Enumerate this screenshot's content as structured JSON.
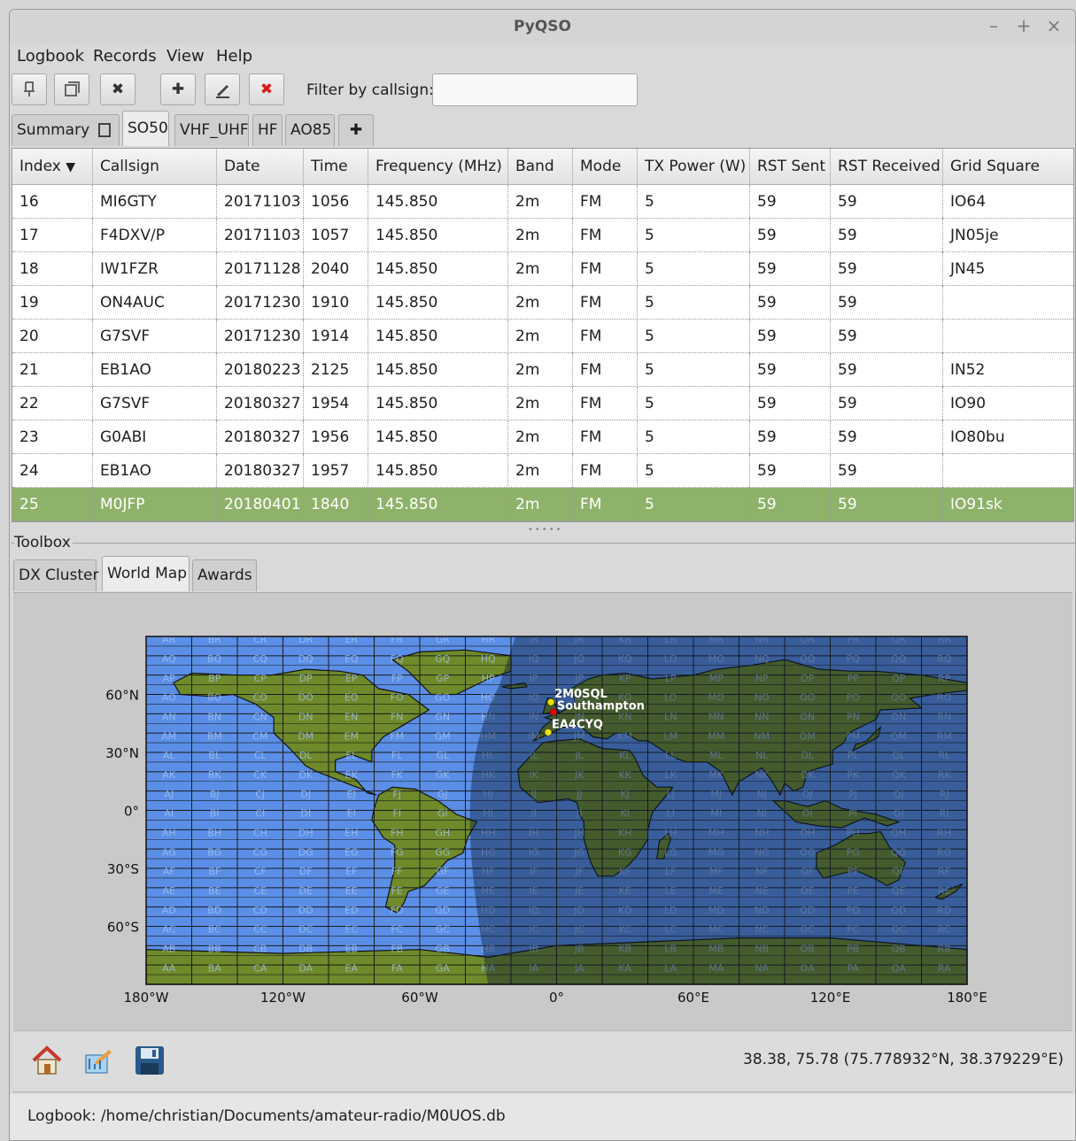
{
  "window": {
    "title": "PyQSO",
    "minimize": "–",
    "maximize": "+",
    "close": "×"
  },
  "menu": [
    "Logbook",
    "Records",
    "View",
    "Help"
  ],
  "toolbar": {
    "filter_label": "Filter by callsign:",
    "filter_value": ""
  },
  "logbook_tabs": [
    "Summary",
    "SO50",
    "VHF_UHF",
    "HF",
    "AO85"
  ],
  "active_logbook_tab": "SO50",
  "columns": [
    "Index",
    "Callsign",
    "Date",
    "Time",
    "Frequency (MHz)",
    "Band",
    "Mode",
    "TX Power (W)",
    "RST Sent",
    "RST Received",
    "Grid Square"
  ],
  "sort_indicator": "▼",
  "rows": [
    [
      "16",
      "MI6GTY",
      "20171103",
      "1056",
      "145.850",
      "2m",
      "FM",
      "5",
      "59",
      "59",
      "IO64"
    ],
    [
      "17",
      "F4DXV/P",
      "20171103",
      "1057",
      "145.850",
      "2m",
      "FM",
      "5",
      "59",
      "59",
      "JN05je"
    ],
    [
      "18",
      "IW1FZR",
      "20171128",
      "2040",
      "145.850",
      "2m",
      "FM",
      "5",
      "59",
      "59",
      "JN45"
    ],
    [
      "19",
      "ON4AUC",
      "20171230",
      "1910",
      "145.850",
      "2m",
      "FM",
      "5",
      "59",
      "59",
      ""
    ],
    [
      "20",
      "G7SVF",
      "20171230",
      "1914",
      "145.850",
      "2m",
      "FM",
      "5",
      "59",
      "59",
      ""
    ],
    [
      "21",
      "EB1AO",
      "20180223",
      "2125",
      "145.850",
      "2m",
      "FM",
      "5",
      "59",
      "59",
      "IN52"
    ],
    [
      "22",
      "G7SVF",
      "20180327",
      "1954",
      "145.850",
      "2m",
      "FM",
      "5",
      "59",
      "59",
      "IO90"
    ],
    [
      "23",
      "G0ABI",
      "20180327",
      "1956",
      "145.850",
      "2m",
      "FM",
      "5",
      "59",
      "59",
      "IO80bu"
    ],
    [
      "24",
      "EB1AO",
      "20180327",
      "1957",
      "145.850",
      "2m",
      "FM",
      "5",
      "59",
      "59",
      ""
    ],
    [
      "25",
      "M0JFP",
      "20180401",
      "1840",
      "145.850",
      "2m",
      "FM",
      "5",
      "59",
      "59",
      "IO91sk"
    ]
  ],
  "selected_row_index": "25",
  "toolbox": {
    "label": "Toolbox",
    "tabs": [
      "DX Cluster",
      "World Map",
      "Awards"
    ],
    "active_tab": "World Map"
  },
  "world_map": {
    "lat_labels": [
      "60°N",
      "30°N",
      "0°",
      "30°S",
      "60°S"
    ],
    "lon_labels": [
      "180°W",
      "120°W",
      "60°W",
      "0°",
      "60°E",
      "120°E",
      "180°E"
    ],
    "markers": [
      {
        "label": "2M0SQL",
        "lon": -2.5,
        "lat": 56.0,
        "color": "#e8e000"
      },
      {
        "label": "Southampton",
        "lon": -1.4,
        "lat": 50.9,
        "color": "#e00000"
      },
      {
        "label": "EA4CYQ",
        "lon": -3.7,
        "lat": 40.4,
        "color": "#e8e000"
      }
    ],
    "field_rows": [
      "R",
      "Q",
      "P",
      "O",
      "N",
      "M",
      "L",
      "K",
      "J",
      "I",
      "H",
      "G",
      "F",
      "E",
      "D",
      "C",
      "B",
      "A"
    ],
    "field_cols": [
      "A",
      "B",
      "C",
      "D",
      "E",
      "F",
      "G",
      "H",
      "I",
      "J",
      "K",
      "L",
      "M",
      "N",
      "O",
      "P",
      "Q",
      "R"
    ],
    "ocean_color": "#5b8ee6",
    "land_color": "#6e8a2a",
    "night_color": "#0a1a33"
  },
  "coordinates_readout": "38.38, 75.78 (75.778932°N, 38.379229°E)",
  "status": "Logbook: /home/christian/Documents/amateur-radio/M0UOS.db"
}
